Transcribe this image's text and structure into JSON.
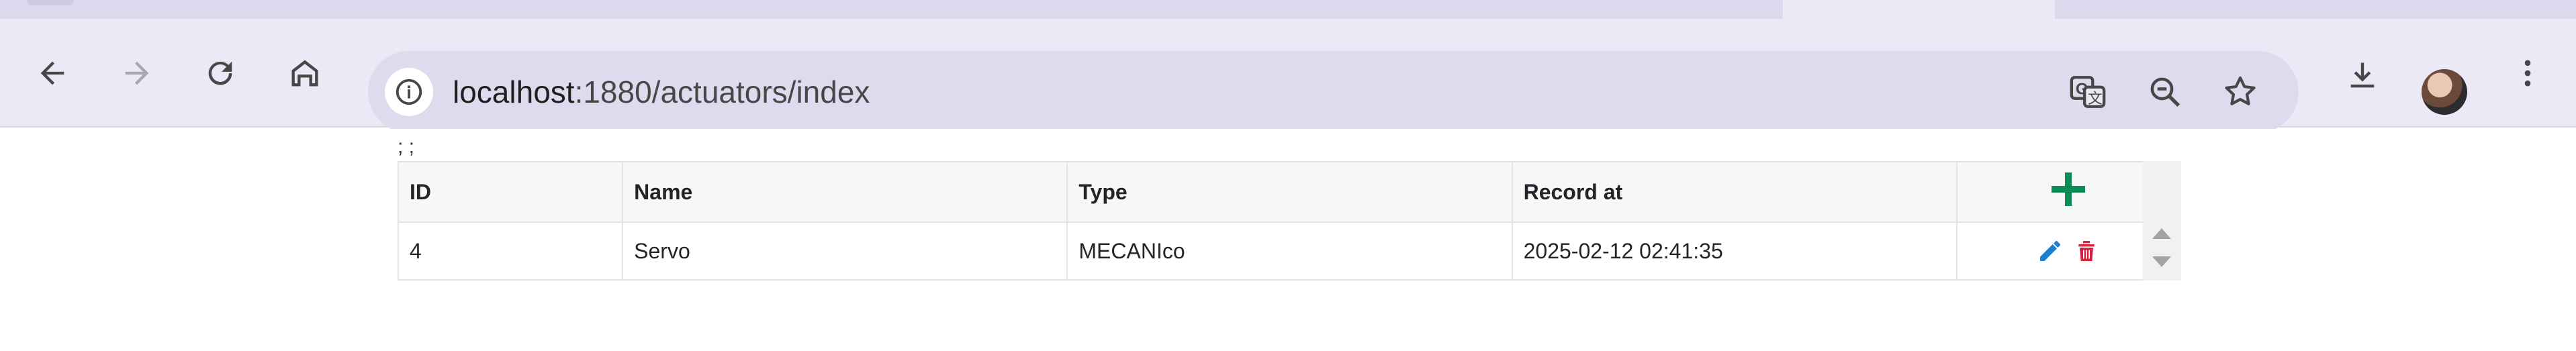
{
  "browser": {
    "url_host": "localhost",
    "url_path": ":1880/actuators/index"
  },
  "page": {
    "stray_text": "; ;"
  },
  "table": {
    "headers": [
      "ID",
      "Name",
      "Type",
      "Record at"
    ],
    "rows": [
      {
        "id": "4",
        "name": "Servo",
        "type": "MECANIco",
        "record_at": "2025-02-12 02:41:35"
      }
    ]
  },
  "colors": {
    "add": "#0a8a55",
    "edit": "#1b7fd1",
    "delete": "#d8213f"
  },
  "icons": [
    "back-icon",
    "forward-icon",
    "reload-icon",
    "home-icon",
    "site-info-icon",
    "translate-icon",
    "zoom-out-icon",
    "bookmark-star-icon",
    "download-icon",
    "profile-avatar",
    "menu-dots-icon",
    "add-icon",
    "edit-icon",
    "delete-icon"
  ]
}
